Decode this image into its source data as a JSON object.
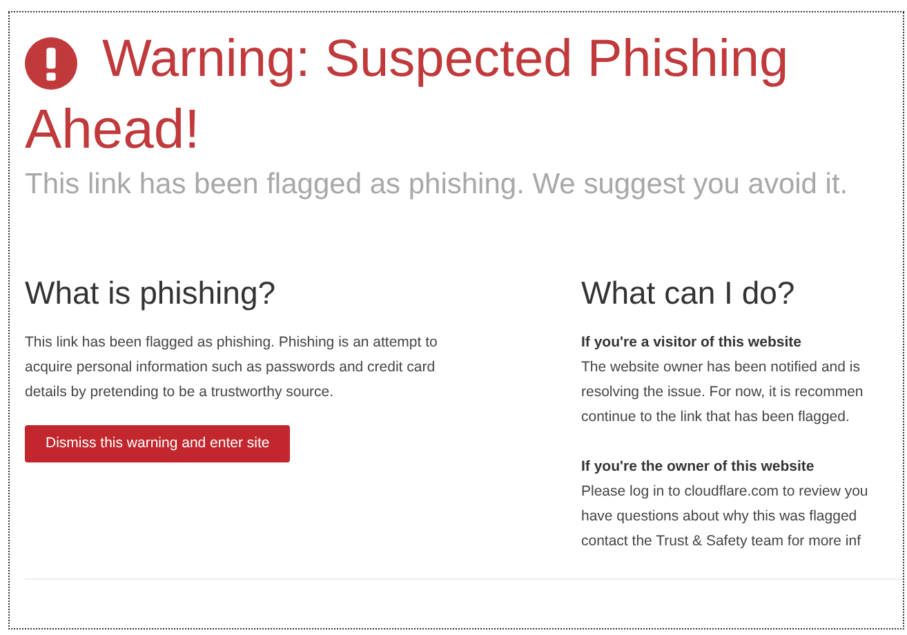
{
  "title": [
    "Warning: Suspected Phishing",
    "Ahead!"
  ],
  "subtitle": "This link has been flagged as phishing. We suggest you avoid it.",
  "left": {
    "heading": "What is phishing?",
    "body": [
      "This link has been flagged as phishing. Phishing is an attempt to",
      "acquire personal information such as passwords and credit card",
      "details by pretending to be a trustworthy source."
    ],
    "button": "Dismiss this warning and enter site"
  },
  "right": {
    "heading": "What can I do?",
    "sections": [
      {
        "heading": "If you're a visitor of this website",
        "body": [
          "The website owner has been notified and is",
          "resolving the issue. For now, it is recommen",
          "continue to the link that has been flagged."
        ]
      },
      {
        "heading": "If you're the owner of this website",
        "body": [
          "Please log in to cloudflare.com to review you",
          "have questions about why this was flagged",
          "contact the Trust & Safety team for more inf"
        ]
      }
    ]
  }
}
